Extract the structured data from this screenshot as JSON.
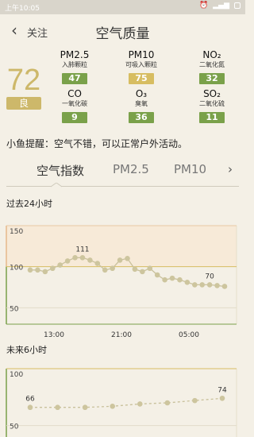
{
  "status_bar": {
    "time": "上午10:05"
  },
  "nav": {
    "back_label": "关注",
    "title": "空气质量"
  },
  "aqi": {
    "value": "72",
    "level": "良"
  },
  "pollutants": [
    {
      "name": "PM2.5",
      "desc": "入肺颗粒",
      "value": "47",
      "color": "green"
    },
    {
      "name": "PM10",
      "desc": "可吸入颗粒",
      "value": "75",
      "color": "yellow"
    },
    {
      "name": "NO₂",
      "desc": "二氧化氮",
      "value": "32",
      "color": "green"
    },
    {
      "name": "CO",
      "desc": "一氧化碳",
      "value": "9",
      "color": "green"
    },
    {
      "name": "O₃",
      "desc": "臭氧",
      "value": "36",
      "color": "green"
    },
    {
      "name": "SO₂",
      "desc": "二氧化硫",
      "value": "11",
      "color": "green"
    }
  ],
  "tip": "小鱼提醒：空气不错，可以正常户外活动。",
  "tabs": [
    "空气指数",
    "PM2.5",
    "PM10"
  ],
  "sections": {
    "past": "过去24小时",
    "future": "未来6小时"
  },
  "colors": {
    "good": "#7aa14a",
    "moderate": "#d7bd61",
    "line_point": "#cdc59e"
  },
  "chart_data": [
    {
      "type": "line",
      "title": "过去24小时",
      "ylim": [
        30,
        150
      ],
      "y_ticks": [
        150,
        100,
        50
      ],
      "x_tick_labels": [
        "13:00",
        "21:00",
        "05:00"
      ],
      "values": [
        96,
        96,
        94,
        98,
        102,
        107,
        111,
        111,
        108,
        104,
        96,
        98,
        108,
        110,
        97,
        94,
        98,
        90,
        84,
        86,
        84,
        81,
        78,
        78,
        78,
        77,
        76
      ],
      "annotations": [
        {
          "index": 7,
          "label": "111"
        },
        {
          "index": 24,
          "label": "70"
        }
      ]
    },
    {
      "type": "line",
      "title": "未来6小时",
      "ylim": [
        40,
        100
      ],
      "y_ticks": [
        100,
        50
      ],
      "values": [
        66,
        66,
        66,
        67,
        69,
        70,
        72,
        74
      ],
      "annotations": [
        {
          "index": 0,
          "label": "66"
        },
        {
          "index": 7,
          "label": "74"
        }
      ]
    }
  ]
}
